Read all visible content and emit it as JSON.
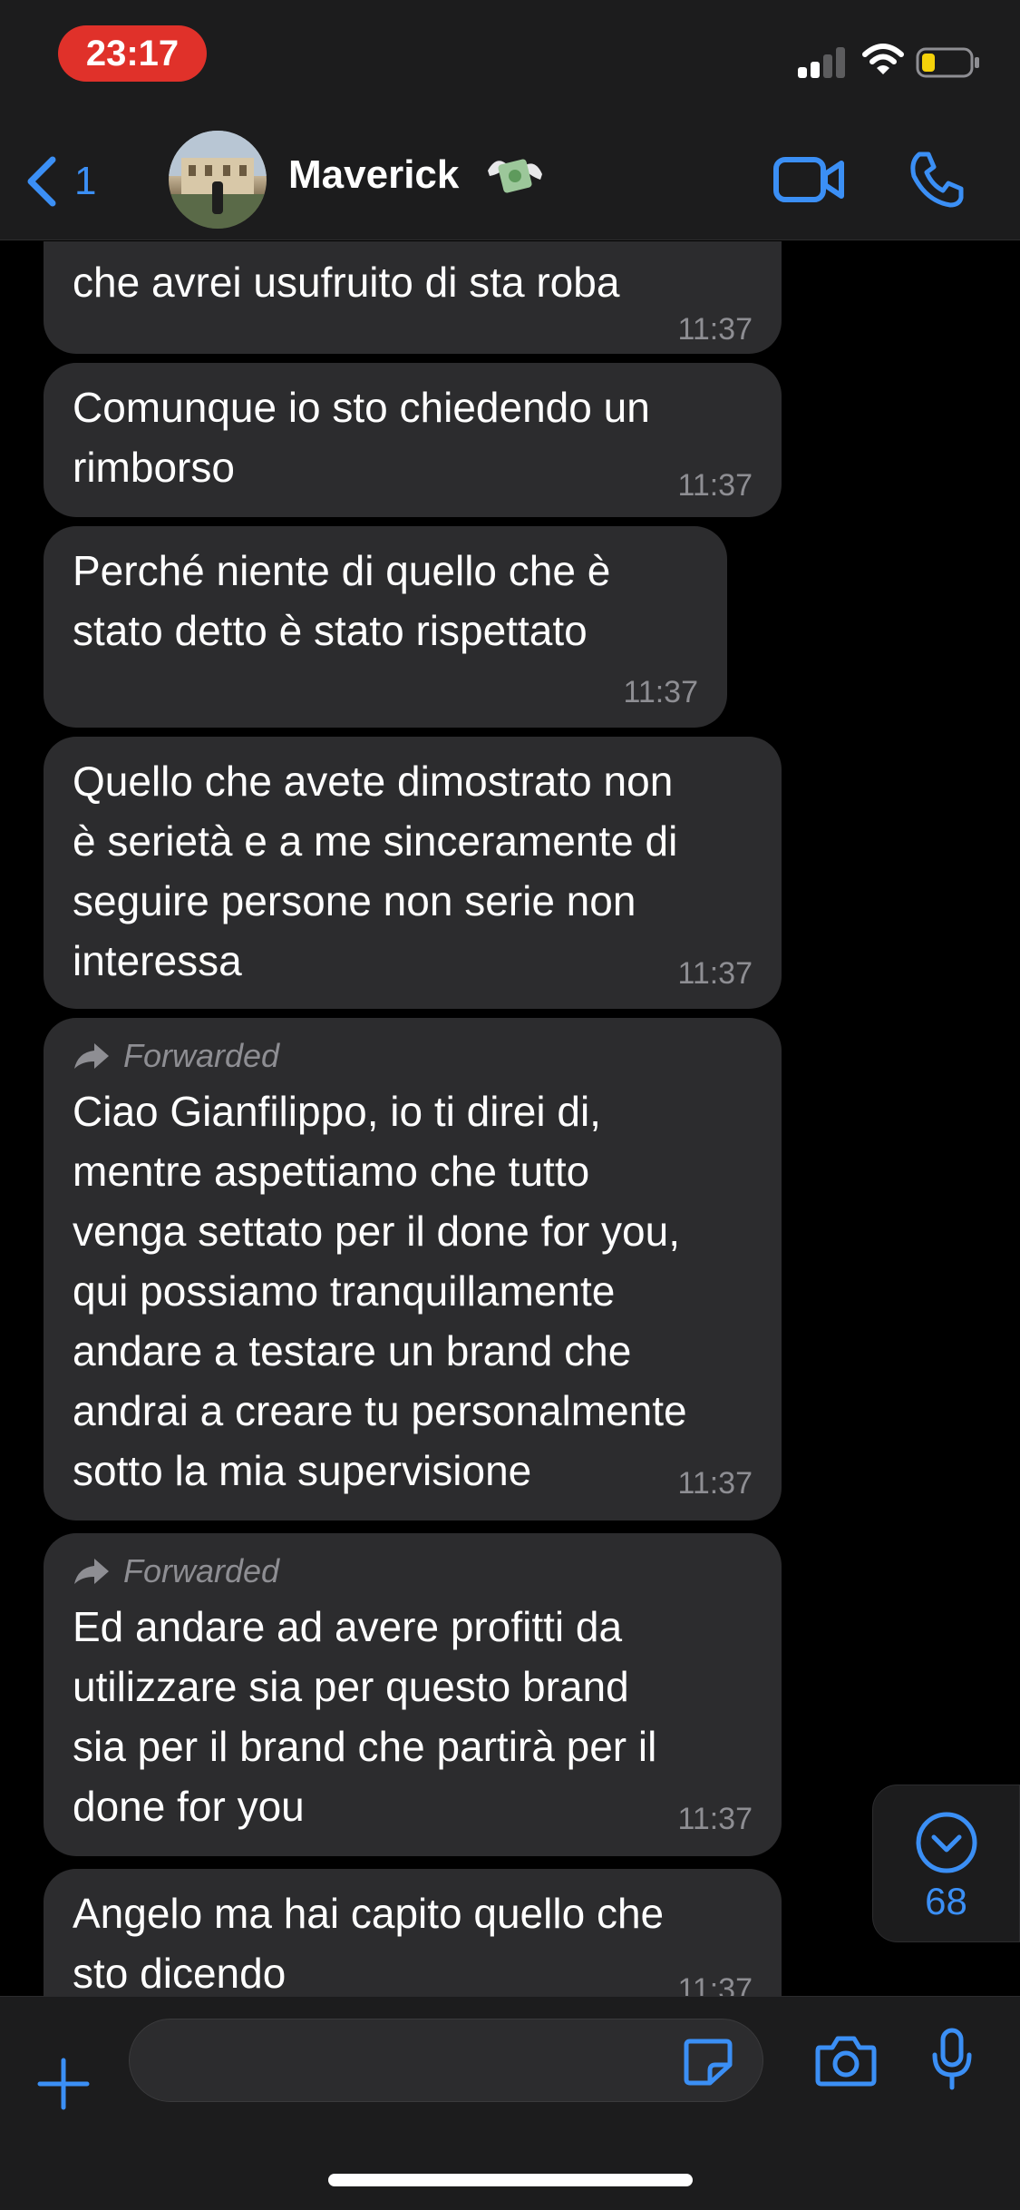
{
  "status_bar": {
    "time": "23:17"
  },
  "header": {
    "back_count": "1",
    "contact_name": "Maverick"
  },
  "messages": [
    {
      "text": "che avrei usufruito di sta roba",
      "time": "11:37"
    },
    {
      "text": "Comunque io sto chiedendo un\nrimborso",
      "time": "11:37"
    },
    {
      "text": "Perché niente di quello che è\nstato detto è stato rispettato",
      "time": "11:37"
    },
    {
      "text": "Quello che avete dimostrato non\nè serietà e a me sinceramente di\nseguire persone non serie non\ninteressa",
      "time": "11:37"
    },
    {
      "forwarded": "Forwarded",
      "text": "Ciao Gianfilippo, io ti direi di,\nmentre aspettiamo che tutto\nvenga settato per il done for you,\nqui possiamo tranquillamente\nandare a testare un brand che\nandrai a creare tu personalmente\nsotto la mia supervisione",
      "time": "11:37"
    },
    {
      "forwarded": "Forwarded",
      "text": "Ed andare ad avere profitti da\nutilizzare sia per questo brand\nsia per il brand che partirà per il\ndone for you",
      "time": "11:37"
    },
    {
      "text": "Angelo ma hai capito quello che\nsto dicendo",
      "time": "11:37"
    }
  ],
  "scroll_badge": {
    "unread_count": "68"
  },
  "input": {
    "placeholder": ""
  },
  "colors": {
    "accent": "#3b8ff5",
    "bubble": "#2c2c2e",
    "bar": "#1c1c1d",
    "time_pill": "#e0312a"
  },
  "icons": [
    "back-chevron-icon",
    "video-call-icon",
    "phone-icon",
    "forward-arrow-icon",
    "chevron-down-icon",
    "plus-icon",
    "sticker-icon",
    "camera-icon",
    "microphone-icon",
    "money-with-wings-icon"
  ]
}
